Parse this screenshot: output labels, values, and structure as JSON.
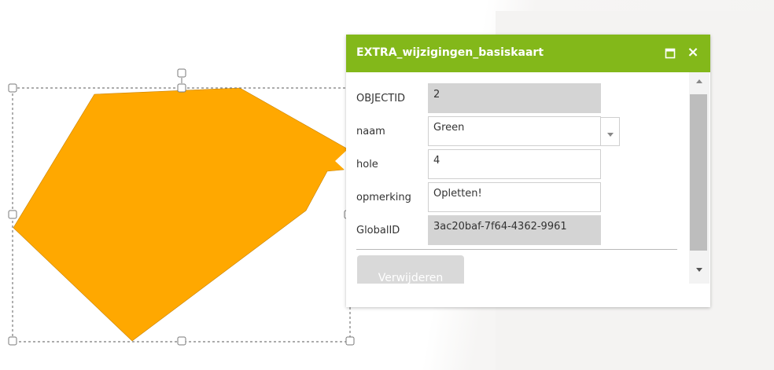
{
  "colors": {
    "header": "#83b81a",
    "polygon_fill": "#ffa800",
    "readonly_field": "#d4d4d4"
  },
  "popup": {
    "title": "EXTRA_wijzigingen_basiskaart",
    "maximize_icon": "maximize-icon",
    "close_icon": "×",
    "fields": [
      {
        "label": "OBJECTID",
        "value": "2",
        "readonly": true
      },
      {
        "label": "naam",
        "value": "Green",
        "type": "dropdown"
      },
      {
        "label": "hole",
        "value": "4"
      },
      {
        "label": "opmerking",
        "value": "Opletten!"
      },
      {
        "label": "GlobalID",
        "value": "3ac20baf-7f64-4362-9961",
        "readonly": true
      }
    ],
    "delete_label": "Verwijderen"
  },
  "map": {
    "feature_icon": "polygon-shape",
    "handles": "vertex-handle-icon"
  }
}
